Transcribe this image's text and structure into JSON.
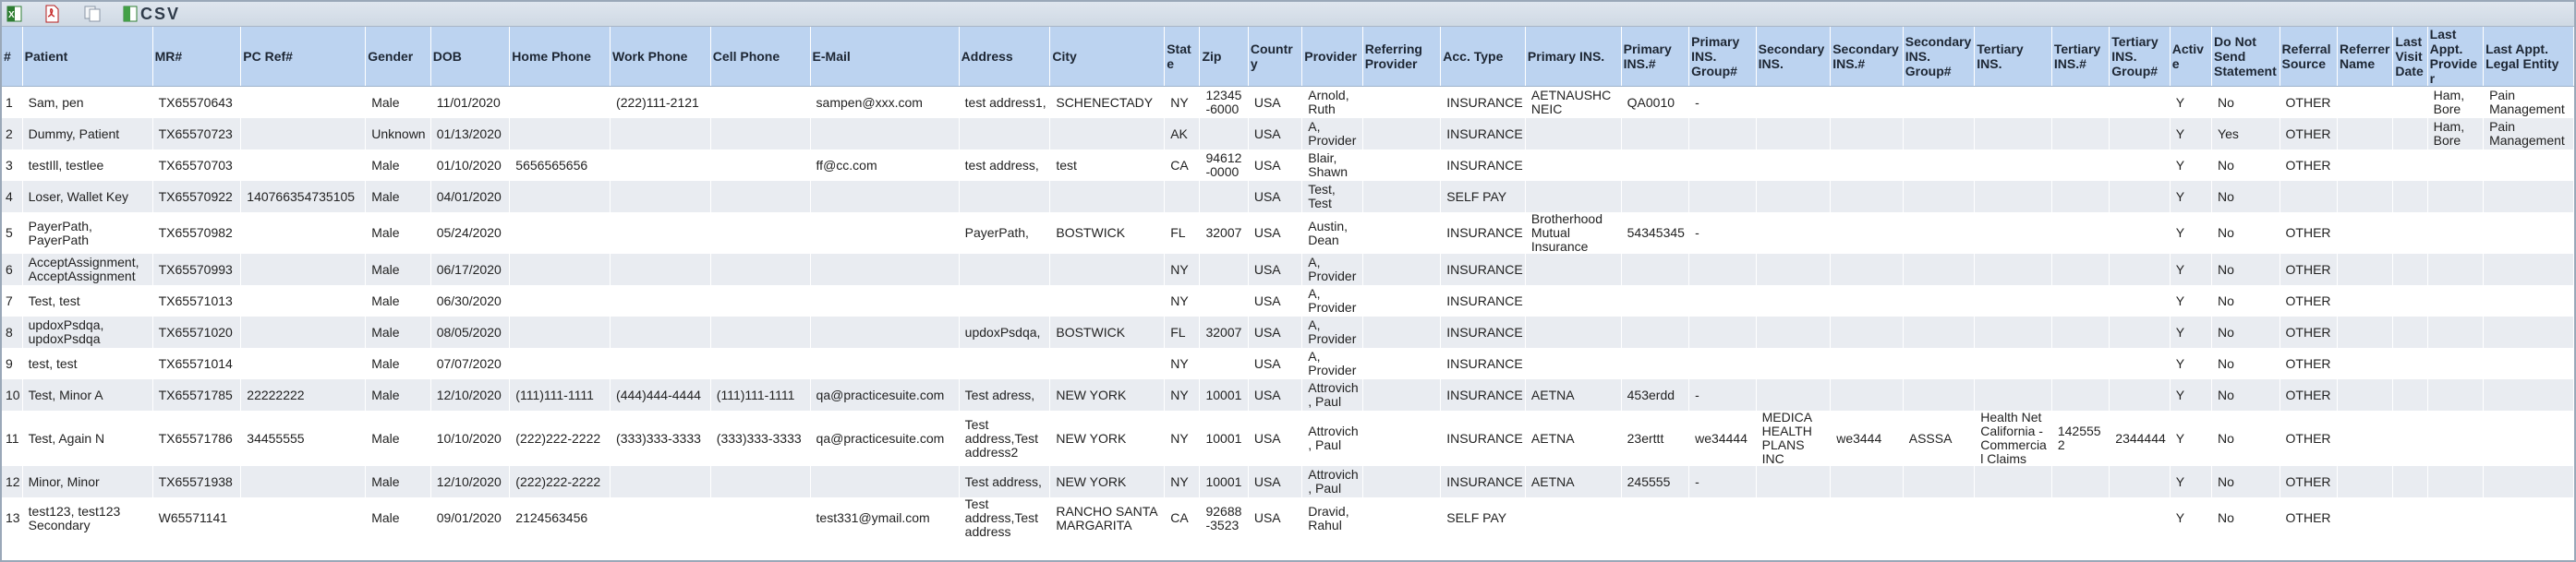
{
  "toolbar": {
    "buttons": [
      {
        "name": "excel-export-icon"
      },
      {
        "name": "pdf-export-icon"
      },
      {
        "name": "copy-icon"
      },
      {
        "name": "csv-export-icon"
      }
    ],
    "csv_label": "CSV"
  },
  "colors": {
    "header_bg": "#bcd3f0",
    "row_alt_bg": "#e9ecf1",
    "toolbar_bg": "#d6dee8"
  },
  "columns": [
    "#",
    "Patient",
    "MR#",
    "PC Ref#",
    "Gender",
    "DOB",
    "Home Phone",
    "Work Phone",
    "Cell Phone",
    "E-Mail",
    "Address",
    "City",
    "State",
    "Zip",
    "Country",
    "Provider",
    "Referring Provider",
    "Acc. Type",
    "Primary INS.",
    "Primary INS.#",
    "Primary INS. Group#",
    "Secondary INS.",
    "Secondary INS.#",
    "Secondary INS. Group#",
    "Tertiary INS.",
    "Tertiary INS.#",
    "Tertiary INS. Group#",
    "Active",
    "Do Not Send Statement",
    "Referral Source",
    "Referrer Name",
    "Last Visit Date",
    "Last Appt. Provider",
    "Last Appt. Legal Entity"
  ],
  "rows": [
    [
      "1",
      "Sam, pen",
      "TX65570643",
      "",
      "Male",
      "11/01/2020",
      "",
      "(222)111-2121",
      "",
      "sampen@xxx.com",
      "test address1,",
      "SCHENECTADY",
      "NY",
      "12345-6000",
      "USA",
      "Arnold, Ruth",
      "",
      "INSURANCE",
      "AETNAUSHC NEIC",
      "QA0010",
      "-",
      "",
      "",
      "",
      "",
      "",
      "",
      "Y",
      "No",
      "OTHER",
      "",
      "",
      "Ham, Bore",
      "Pain Management"
    ],
    [
      "2",
      "Dummy, Patient",
      "TX65570723",
      "",
      "Unknown",
      "01/13/2020",
      "",
      "",
      "",
      "",
      "",
      "",
      "AK",
      "",
      "USA",
      "A, Provider",
      "",
      "INSURANCE",
      "",
      "",
      "",
      "",
      "",
      "",
      "",
      "",
      "",
      "Y",
      "Yes",
      "OTHER",
      "",
      "",
      "Ham, Bore",
      "Pain Management"
    ],
    [
      "3",
      "testIll, testlee",
      "TX65570703",
      "",
      "Male",
      "01/10/2020",
      "5656565656",
      "",
      "",
      "ff@cc.com",
      "test address,",
      "test",
      "CA",
      "94612-0000",
      "USA",
      "Blair, Shawn",
      "",
      "INSURANCE",
      "",
      "",
      "",
      "",
      "",
      "",
      "",
      "",
      "",
      "Y",
      "No",
      "OTHER",
      "",
      "",
      "",
      ""
    ],
    [
      "4",
      "Loser, Wallet Key",
      "TX65570922",
      "140766354735105",
      "Male",
      "04/01/2020",
      "",
      "",
      "",
      "",
      "",
      "",
      "",
      "",
      "USA",
      "Test, Test",
      "",
      "SELF PAY",
      "",
      "",
      "",
      "",
      "",
      "",
      "",
      "",
      "",
      "Y",
      "No",
      "",
      "",
      "",
      "",
      ""
    ],
    [
      "5",
      "PayerPath, PayerPath",
      "TX65570982",
      "",
      "Male",
      "05/24/2020",
      "",
      "",
      "",
      "",
      "PayerPath,",
      "BOSTWICK",
      "FL",
      "32007",
      "USA",
      "Austin, Dean",
      "",
      "INSURANCE",
      "Brotherhood Mutual Insurance",
      "54345345",
      "-",
      "",
      "",
      "",
      "",
      "",
      "",
      "Y",
      "No",
      "OTHER",
      "",
      "",
      "",
      ""
    ],
    [
      "6",
      "AcceptAssignment, AcceptAssignment",
      "TX65570993",
      "",
      "Male",
      "06/17/2020",
      "",
      "",
      "",
      "",
      "",
      "",
      "NY",
      "",
      "USA",
      "A, Provider",
      "",
      "INSURANCE",
      "",
      "",
      "",
      "",
      "",
      "",
      "",
      "",
      "",
      "Y",
      "No",
      "OTHER",
      "",
      "",
      "",
      ""
    ],
    [
      "7",
      "Test, test",
      "TX65571013",
      "",
      "Male",
      "06/30/2020",
      "",
      "",
      "",
      "",
      "",
      "",
      "NY",
      "",
      "USA",
      "A, Provider",
      "",
      "INSURANCE",
      "",
      "",
      "",
      "",
      "",
      "",
      "",
      "",
      "",
      "Y",
      "No",
      "OTHER",
      "",
      "",
      "",
      ""
    ],
    [
      "8",
      "updoxPsdqa, updoxPsdqa",
      "TX65571020",
      "",
      "Male",
      "08/05/2020",
      "",
      "",
      "",
      "",
      "updoxPsdqa,",
      "BOSTWICK",
      "FL",
      "32007",
      "USA",
      "A, Provider",
      "",
      "INSURANCE",
      "",
      "",
      "",
      "",
      "",
      "",
      "",
      "",
      "",
      "Y",
      "No",
      "OTHER",
      "",
      "",
      "",
      ""
    ],
    [
      "9",
      "test, test",
      "TX65571014",
      "",
      "Male",
      "07/07/2020",
      "",
      "",
      "",
      "",
      "",
      "",
      "NY",
      "",
      "USA",
      "A, Provider",
      "",
      "INSURANCE",
      "",
      "",
      "",
      "",
      "",
      "",
      "",
      "",
      "",
      "Y",
      "No",
      "OTHER",
      "",
      "",
      "",
      ""
    ],
    [
      "10",
      "Test, Minor A",
      "TX65571785",
      "22222222",
      "Male",
      "12/10/2020",
      "(111)111-1111",
      "(444)444-4444",
      "(111)111-1111",
      "qa@practicesuite.com",
      "Test adress,",
      "NEW YORK",
      "NY",
      "10001",
      "USA",
      "Attrovich, Paul",
      "",
      "INSURANCE",
      "AETNA",
      "453erdd",
      "-",
      "",
      "",
      "",
      "",
      "",
      "",
      "Y",
      "No",
      "OTHER",
      "",
      "",
      "",
      ""
    ],
    [
      "11",
      "Test, Again N",
      "TX65571786",
      "34455555",
      "Male",
      "10/10/2020",
      "(222)222-2222",
      "(333)333-3333",
      "(333)333-3333",
      "qa@practicesuite.com",
      "Test address,Test address2",
      "NEW YORK",
      "NY",
      "10001",
      "USA",
      "Attrovich, Paul",
      "",
      "INSURANCE",
      "AETNA",
      "23erttt",
      "we34444",
      "MEDICA HEALTH PLANS INC",
      "we3444",
      "ASSSA",
      "Health Net California - Commercial Claims",
      "1425552",
      "2344444",
      "Y",
      "No",
      "OTHER",
      "",
      "",
      "",
      ""
    ],
    [
      "12",
      "Minor, Minor",
      "TX65571938",
      "",
      "Male",
      "12/10/2020",
      "(222)222-2222",
      "",
      "",
      "",
      "Test address,",
      "NEW YORK",
      "NY",
      "10001",
      "USA",
      "Attrovich, Paul",
      "",
      "INSURANCE",
      "AETNA",
      "245555",
      "-",
      "",
      "",
      "",
      "",
      "",
      "",
      "Y",
      "No",
      "OTHER",
      "",
      "",
      "",
      ""
    ],
    [
      "13",
      "test123, test123 Secondary",
      "W65571141",
      "",
      "Male",
      "09/01/2020",
      "2124563456",
      "",
      "",
      "test331@ymail.com",
      "Test address,Test address",
      "RANCHO SANTA MARGARITA",
      "CA",
      "92688-3523",
      "USA",
      "Dravid, Rahul",
      "",
      "SELF PAY",
      "",
      "",
      "",
      "",
      "",
      "",
      "",
      "",
      "",
      "Y",
      "No",
      "OTHER",
      "",
      "",
      "",
      ""
    ]
  ]
}
